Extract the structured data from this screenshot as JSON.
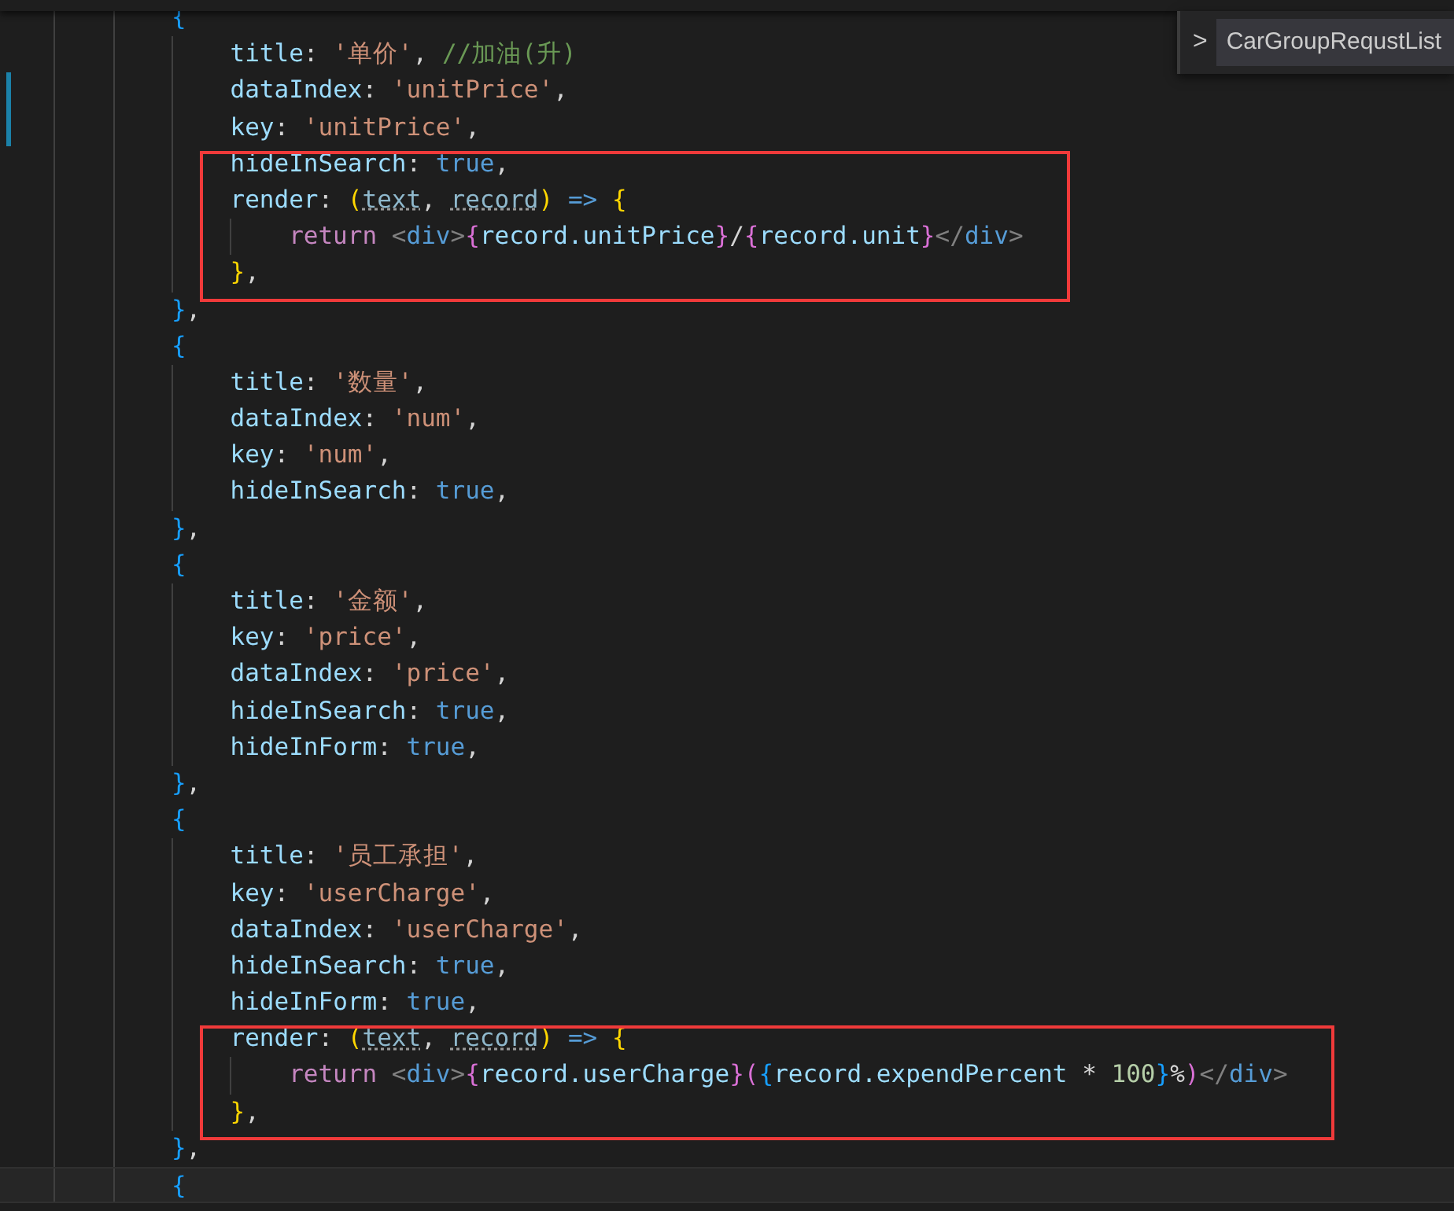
{
  "symbol_widget": {
    "chevron": ">",
    "label": "CarGroupRequstList"
  },
  "lines": [
    {
      "modified": false,
      "current": false,
      "boxed": false,
      "tokens": [
        {
          "kind": "b3",
          "text": "{"
        }
      ],
      "children": [
        {
          "modified": false,
          "current": false,
          "boxed": false,
          "tokens": [
            {
              "kind": "prop",
              "text": "title"
            },
            {
              "kind": "punct",
              "text": ": "
            },
            {
              "kind": "str",
              "text": "'单价'"
            },
            {
              "kind": "punct",
              "text": ", "
            },
            {
              "kind": "comment",
              "text": "//加油(升)"
            }
          ]
        },
        {
          "modified": true,
          "current": false,
          "boxed": false,
          "tokens": [
            {
              "kind": "prop",
              "text": "dataIndex"
            },
            {
              "kind": "punct",
              "text": ": "
            },
            {
              "kind": "str",
              "text": "'unitPrice'"
            },
            {
              "kind": "punct",
              "text": ","
            }
          ]
        },
        {
          "modified": true,
          "current": false,
          "boxed": false,
          "tokens": [
            {
              "kind": "prop",
              "text": "key"
            },
            {
              "kind": "punct",
              "text": ": "
            },
            {
              "kind": "str",
              "text": "'unitPrice'"
            },
            {
              "kind": "punct",
              "text": ","
            }
          ]
        },
        {
          "modified": false,
          "current": false,
          "boxed": true,
          "tokens": [
            {
              "kind": "prop",
              "text": "hideInSearch"
            },
            {
              "kind": "punct",
              "text": ": "
            },
            {
              "kind": "bool",
              "text": "true"
            },
            {
              "kind": "punct",
              "text": ","
            }
          ]
        },
        {
          "modified": false,
          "current": false,
          "boxed": true,
          "tokens": [
            {
              "kind": "prop",
              "text": "render"
            },
            {
              "kind": "punct",
              "text": ": "
            },
            {
              "kind": "b1",
              "text": "("
            },
            {
              "kind": "param",
              "text": "text"
            },
            {
              "kind": "punct",
              "text": ", "
            },
            {
              "kind": "param",
              "text": "record"
            },
            {
              "kind": "b1",
              "text": ")"
            },
            {
              "kind": "op",
              "text": " => "
            },
            {
              "kind": "b1",
              "text": "{"
            }
          ],
          "children": [
            {
              "modified": false,
              "current": false,
              "boxed": true,
              "tokens": [
                {
                  "kind": "kw",
                  "text": "return"
                },
                {
                  "kind": "tagp",
                  "text": " <"
                },
                {
                  "kind": "tag",
                  "text": "div"
                },
                {
                  "kind": "tagp",
                  "text": ">"
                },
                {
                  "kind": "b2",
                  "text": "{"
                },
                {
                  "kind": "var",
                  "text": "record.unitPrice"
                },
                {
                  "kind": "b2",
                  "text": "}"
                },
                {
                  "kind": "punct",
                  "text": "/"
                },
                {
                  "kind": "b2",
                  "text": "{"
                },
                {
                  "kind": "var",
                  "text": "record.unit"
                },
                {
                  "kind": "b2",
                  "text": "}"
                },
                {
                  "kind": "tagp",
                  "text": "</"
                },
                {
                  "kind": "tag",
                  "text": "div"
                },
                {
                  "kind": "tagp",
                  "text": ">"
                }
              ]
            }
          ]
        },
        {
          "modified": false,
          "current": false,
          "boxed": true,
          "tokens": [
            {
              "kind": "b1",
              "text": "}"
            },
            {
              "kind": "punct",
              "text": ","
            }
          ]
        }
      ]
    },
    {
      "modified": false,
      "current": false,
      "boxed": false,
      "tokens": [
        {
          "kind": "b3",
          "text": "}"
        },
        {
          "kind": "punct",
          "text": ","
        }
      ]
    },
    {
      "modified": false,
      "current": false,
      "boxed": false,
      "tokens": [
        {
          "kind": "b3",
          "text": "{"
        }
      ],
      "children": [
        {
          "modified": false,
          "current": false,
          "boxed": false,
          "tokens": [
            {
              "kind": "prop",
              "text": "title"
            },
            {
              "kind": "punct",
              "text": ": "
            },
            {
              "kind": "str",
              "text": "'数量'"
            },
            {
              "kind": "punct",
              "text": ","
            }
          ]
        },
        {
          "modified": false,
          "current": false,
          "boxed": false,
          "tokens": [
            {
              "kind": "prop",
              "text": "dataIndex"
            },
            {
              "kind": "punct",
              "text": ": "
            },
            {
              "kind": "str",
              "text": "'num'"
            },
            {
              "kind": "punct",
              "text": ","
            }
          ]
        },
        {
          "modified": false,
          "current": false,
          "boxed": false,
          "tokens": [
            {
              "kind": "prop",
              "text": "key"
            },
            {
              "kind": "punct",
              "text": ": "
            },
            {
              "kind": "str",
              "text": "'num'"
            },
            {
              "kind": "punct",
              "text": ","
            }
          ]
        },
        {
          "modified": false,
          "current": false,
          "boxed": false,
          "tokens": [
            {
              "kind": "prop",
              "text": "hideInSearch"
            },
            {
              "kind": "punct",
              "text": ": "
            },
            {
              "kind": "bool",
              "text": "true"
            },
            {
              "kind": "punct",
              "text": ","
            }
          ]
        }
      ]
    },
    {
      "modified": false,
      "current": false,
      "boxed": false,
      "tokens": [
        {
          "kind": "b3",
          "text": "}"
        },
        {
          "kind": "punct",
          "text": ","
        }
      ]
    },
    {
      "modified": false,
      "current": false,
      "boxed": false,
      "tokens": [
        {
          "kind": "b3",
          "text": "{"
        }
      ],
      "children": [
        {
          "modified": false,
          "current": false,
          "boxed": false,
          "tokens": [
            {
              "kind": "prop",
              "text": "title"
            },
            {
              "kind": "punct",
              "text": ": "
            },
            {
              "kind": "str",
              "text": "'金额'"
            },
            {
              "kind": "punct",
              "text": ","
            }
          ]
        },
        {
          "modified": false,
          "current": false,
          "boxed": false,
          "tokens": [
            {
              "kind": "prop",
              "text": "key"
            },
            {
              "kind": "punct",
              "text": ": "
            },
            {
              "kind": "str",
              "text": "'price'"
            },
            {
              "kind": "punct",
              "text": ","
            }
          ]
        },
        {
          "modified": false,
          "current": false,
          "boxed": false,
          "tokens": [
            {
              "kind": "prop",
              "text": "dataIndex"
            },
            {
              "kind": "punct",
              "text": ": "
            },
            {
              "kind": "str",
              "text": "'price'"
            },
            {
              "kind": "punct",
              "text": ","
            }
          ]
        },
        {
          "modified": false,
          "current": false,
          "boxed": false,
          "tokens": [
            {
              "kind": "prop",
              "text": "hideInSearch"
            },
            {
              "kind": "punct",
              "text": ": "
            },
            {
              "kind": "bool",
              "text": "true"
            },
            {
              "kind": "punct",
              "text": ","
            }
          ]
        },
        {
          "modified": false,
          "current": false,
          "boxed": false,
          "tokens": [
            {
              "kind": "prop",
              "text": "hideInForm"
            },
            {
              "kind": "punct",
              "text": ": "
            },
            {
              "kind": "bool",
              "text": "true"
            },
            {
              "kind": "punct",
              "text": ","
            }
          ]
        }
      ]
    },
    {
      "modified": false,
      "current": false,
      "boxed": false,
      "tokens": [
        {
          "kind": "b3",
          "text": "}"
        },
        {
          "kind": "punct",
          "text": ","
        }
      ]
    },
    {
      "modified": false,
      "current": false,
      "boxed": false,
      "tokens": [
        {
          "kind": "b3",
          "text": "{"
        }
      ],
      "children": [
        {
          "modified": false,
          "current": false,
          "boxed": false,
          "tokens": [
            {
              "kind": "prop",
              "text": "title"
            },
            {
              "kind": "punct",
              "text": ": "
            },
            {
              "kind": "str",
              "text": "'员工承担'"
            },
            {
              "kind": "punct",
              "text": ","
            }
          ]
        },
        {
          "modified": false,
          "current": false,
          "boxed": false,
          "tokens": [
            {
              "kind": "prop",
              "text": "key"
            },
            {
              "kind": "punct",
              "text": ": "
            },
            {
              "kind": "str",
              "text": "'userCharge'"
            },
            {
              "kind": "punct",
              "text": ","
            }
          ]
        },
        {
          "modified": false,
          "current": false,
          "boxed": false,
          "tokens": [
            {
              "kind": "prop",
              "text": "dataIndex"
            },
            {
              "kind": "punct",
              "text": ": "
            },
            {
              "kind": "str",
              "text": "'userCharge'"
            },
            {
              "kind": "punct",
              "text": ","
            }
          ]
        },
        {
          "modified": false,
          "current": false,
          "boxed": false,
          "tokens": [
            {
              "kind": "prop",
              "text": "hideInSearch"
            },
            {
              "kind": "punct",
              "text": ": "
            },
            {
              "kind": "bool",
              "text": "true"
            },
            {
              "kind": "punct",
              "text": ","
            }
          ]
        },
        {
          "modified": false,
          "current": false,
          "boxed": false,
          "tokens": [
            {
              "kind": "prop",
              "text": "hideInForm"
            },
            {
              "kind": "punct",
              "text": ": "
            },
            {
              "kind": "bool",
              "text": "true"
            },
            {
              "kind": "punct",
              "text": ","
            }
          ]
        },
        {
          "modified": false,
          "current": false,
          "boxed": true,
          "tokens": [
            {
              "kind": "prop",
              "text": "render"
            },
            {
              "kind": "punct",
              "text": ": "
            },
            {
              "kind": "b1",
              "text": "("
            },
            {
              "kind": "param",
              "text": "text"
            },
            {
              "kind": "punct",
              "text": ", "
            },
            {
              "kind": "param",
              "text": "record"
            },
            {
              "kind": "b1",
              "text": ")"
            },
            {
              "kind": "op",
              "text": " => "
            },
            {
              "kind": "b1",
              "text": "{"
            }
          ],
          "children": [
            {
              "modified": false,
              "current": false,
              "boxed": true,
              "tokens": [
                {
                  "kind": "kw",
                  "text": "return"
                },
                {
                  "kind": "tagp",
                  "text": " <"
                },
                {
                  "kind": "tag",
                  "text": "div"
                },
                {
                  "kind": "tagp",
                  "text": ">"
                },
                {
                  "kind": "b2",
                  "text": "{"
                },
                {
                  "kind": "var",
                  "text": "record.userCharge"
                },
                {
                  "kind": "b2",
                  "text": "}"
                },
                {
                  "kind": "b2",
                  "text": "("
                },
                {
                  "kind": "b3",
                  "text": "{"
                },
                {
                  "kind": "var",
                  "text": "record.expendPercent"
                },
                {
                  "kind": "punct",
                  "text": " * "
                },
                {
                  "kind": "num",
                  "text": "100"
                },
                {
                  "kind": "b3",
                  "text": "}"
                },
                {
                  "kind": "punct",
                  "text": "%"
                },
                {
                  "kind": "b2",
                  "text": ")"
                },
                {
                  "kind": "tagp",
                  "text": "</"
                },
                {
                  "kind": "tag",
                  "text": "div"
                },
                {
                  "kind": "tagp",
                  "text": ">"
                }
              ]
            }
          ]
        },
        {
          "modified": false,
          "current": false,
          "boxed": true,
          "tokens": [
            {
              "kind": "b1",
              "text": "}"
            },
            {
              "kind": "punct",
              "text": ","
            }
          ]
        }
      ]
    },
    {
      "modified": false,
      "current": false,
      "boxed": false,
      "tokens": [
        {
          "kind": "b3",
          "text": "}"
        },
        {
          "kind": "punct",
          "text": ","
        }
      ]
    },
    {
      "modified": false,
      "current": true,
      "boxed": false,
      "tokens": [
        {
          "kind": "b3",
          "text": "{"
        }
      ]
    }
  ]
}
